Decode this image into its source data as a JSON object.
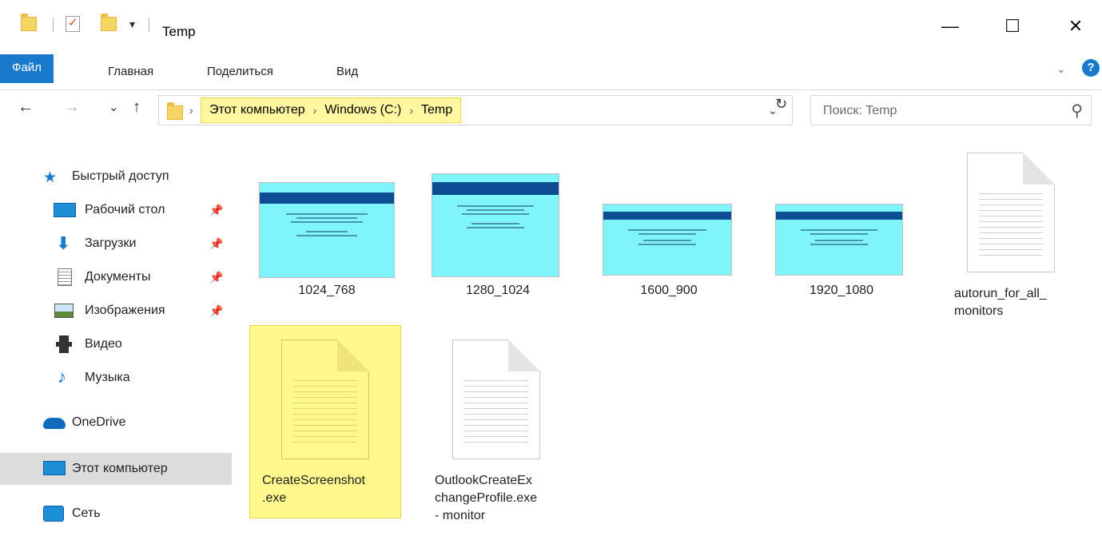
{
  "window": {
    "title": "Temp",
    "minimize_glyph": "—",
    "maximize_glyph": "☐",
    "close_glyph": "✕"
  },
  "quick_access_toolbar": {
    "icons": [
      "folder-icon",
      "properties-icon",
      "new-folder-icon",
      "customize-arrow-icon"
    ],
    "dropdown_glyph": "▾"
  },
  "ribbon": {
    "file_tab": "Файл",
    "tabs": [
      "Главная",
      "Поделиться",
      "Вид"
    ],
    "expand_glyph": "⌄",
    "help_glyph": "?"
  },
  "navigation": {
    "back_glyph": "←",
    "forward_glyph": "→",
    "recent_glyph": "⌄",
    "up_glyph": "↑",
    "breadcrumb": [
      "Этот компьютер",
      "Windows (C:)",
      "Temp"
    ],
    "breadcrumb_sep": "›",
    "address_dropdown_glyph": "⌄",
    "refresh_glyph": "↻",
    "search_placeholder": "Поиск: Temp",
    "search_glyph": "⚲"
  },
  "sidebar": {
    "quick_access": "Быстрый доступ",
    "items": [
      {
        "label": "Рабочий стол",
        "pinned": true
      },
      {
        "label": "Загрузки",
        "pinned": true
      },
      {
        "label": "Документы",
        "pinned": true
      },
      {
        "label": "Изображения",
        "pinned": true
      },
      {
        "label": "Видео",
        "pinned": false
      },
      {
        "label": "Музыка",
        "pinned": false
      }
    ],
    "pin_glyph": "📌",
    "onedrive": "OneDrive",
    "this_pc": "Этот компьютер",
    "network": "Сеть"
  },
  "files": [
    {
      "name": "1024_768",
      "type": "image"
    },
    {
      "name": "1280_1024",
      "type": "image"
    },
    {
      "name": "1600_900",
      "type": "image"
    },
    {
      "name": "1920_1080",
      "type": "image"
    },
    {
      "name_lines": [
        "autorun_for_all_",
        "monitors"
      ],
      "type": "text"
    },
    {
      "name_lines": [
        "CreateScreenshot",
        ".exe"
      ],
      "type": "text",
      "selected": true
    },
    {
      "name_lines": [
        "OutlookCreateEx",
        "changeProfile.exe",
        "- monitor"
      ],
      "type": "text"
    }
  ],
  "colors": {
    "accent": "#1979ca",
    "highlight": "#fff88d",
    "thumb_bg": "#7ff5fb",
    "thumb_bar": "#0e4c93"
  }
}
